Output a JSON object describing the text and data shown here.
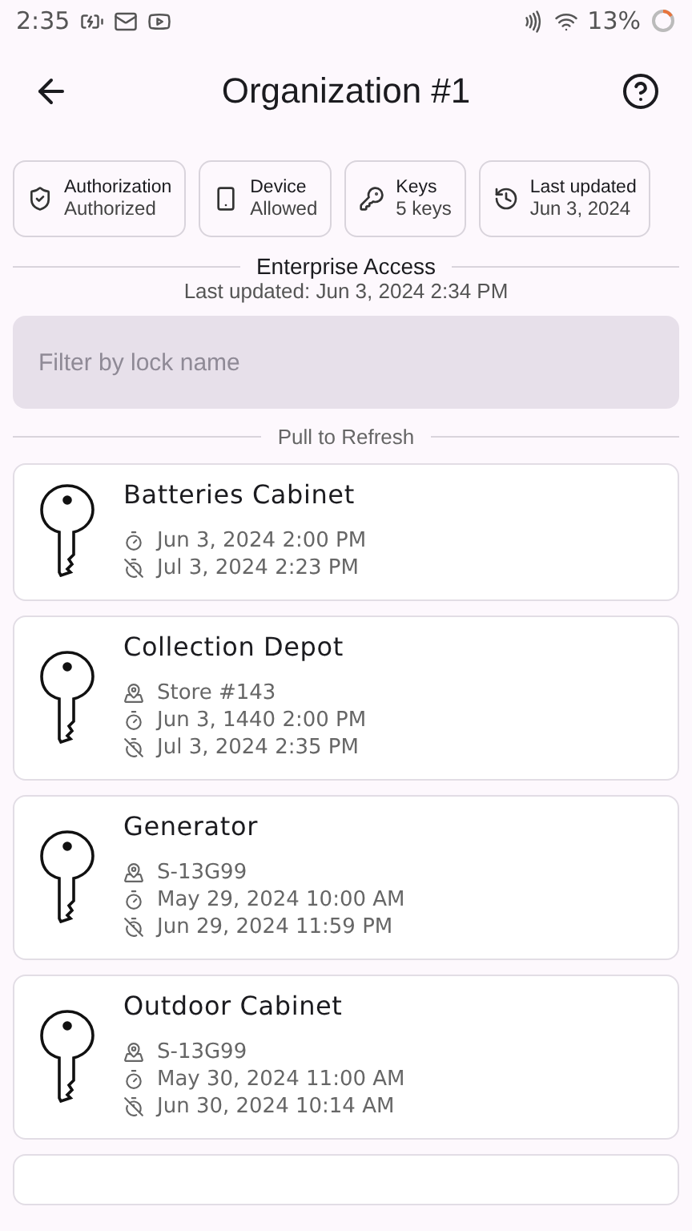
{
  "status_bar": {
    "time": "2:35",
    "battery": "13%"
  },
  "header": {
    "title": "Organization #1"
  },
  "chips": [
    {
      "kind": "authorization",
      "label": "Authorization",
      "value": "Authorized"
    },
    {
      "kind": "device",
      "label": "Device",
      "value": "Allowed"
    },
    {
      "kind": "keys",
      "label": "Keys",
      "value": "5 keys"
    },
    {
      "kind": "updated",
      "label": "Last updated",
      "value": "Jun 3, 2024"
    }
  ],
  "section": {
    "title": "Enterprise Access",
    "subtitle": "Last updated: Jun 3, 2024 2:34 PM"
  },
  "filter": {
    "placeholder": "Filter by lock name"
  },
  "refresh_label": "Pull to Refresh",
  "locks": [
    {
      "name": "Batteries Cabinet",
      "details": [
        {
          "kind": "start",
          "text": "Jun 3, 2024 2:00 PM"
        },
        {
          "kind": "end",
          "text": "Jul 3, 2024 2:23 PM"
        }
      ]
    },
    {
      "name": "Collection Depot",
      "details": [
        {
          "kind": "location",
          "text": "Store #143"
        },
        {
          "kind": "start",
          "text": "Jun 3, 1440 2:00 PM"
        },
        {
          "kind": "end",
          "text": "Jul 3, 2024 2:35 PM"
        }
      ]
    },
    {
      "name": "Generator",
      "details": [
        {
          "kind": "location",
          "text": "S-13G99"
        },
        {
          "kind": "start",
          "text": "May 29, 2024 10:00 AM"
        },
        {
          "kind": "end",
          "text": "Jun 29, 2024 11:59 PM"
        }
      ]
    },
    {
      "name": "Outdoor Cabinet",
      "details": [
        {
          "kind": "location",
          "text": "S-13G99"
        },
        {
          "kind": "start",
          "text": "May 30, 2024 11:00 AM"
        },
        {
          "kind": "end",
          "text": "Jun 30, 2024 10:14 AM"
        }
      ]
    }
  ]
}
